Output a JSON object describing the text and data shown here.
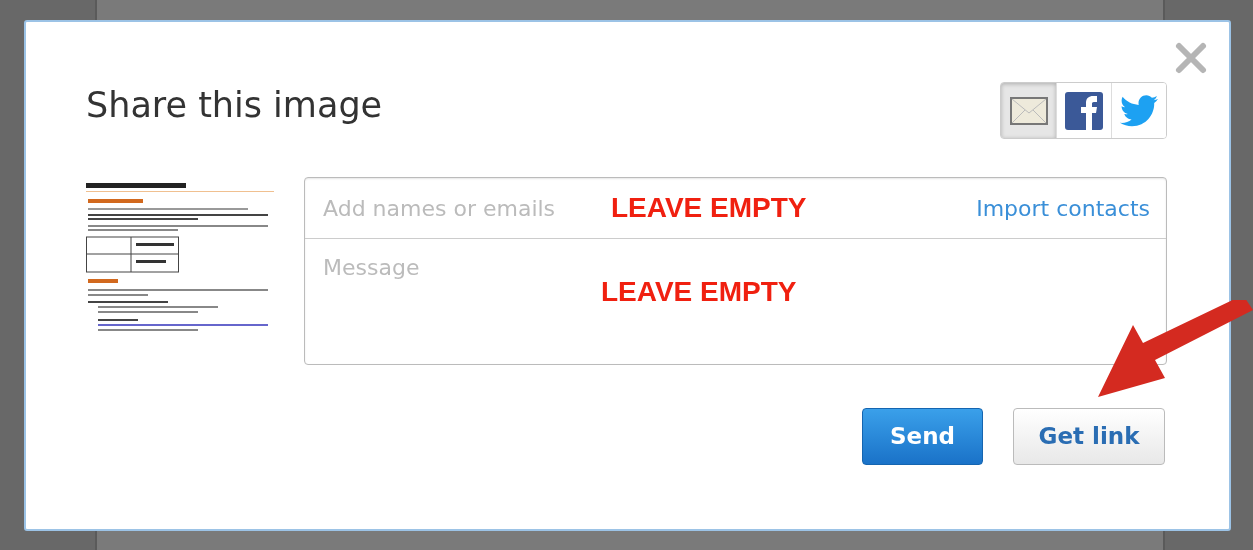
{
  "dialog": {
    "title": "Share this image",
    "share_tabs": [
      {
        "kind": "email",
        "selected": true
      },
      {
        "kind": "facebook",
        "selected": false
      },
      {
        "kind": "twitter",
        "selected": false
      }
    ],
    "recipients": {
      "placeholder": "Add names or emails",
      "annotation": "LEAVE EMPTY"
    },
    "import_link": "Import contacts",
    "message": {
      "placeholder": "Message",
      "annotation": "LEAVE EMPTY"
    },
    "buttons": [
      {
        "label": "Send",
        "kind": "primary"
      },
      {
        "label": "Get link",
        "kind": "secondary"
      }
    ]
  }
}
